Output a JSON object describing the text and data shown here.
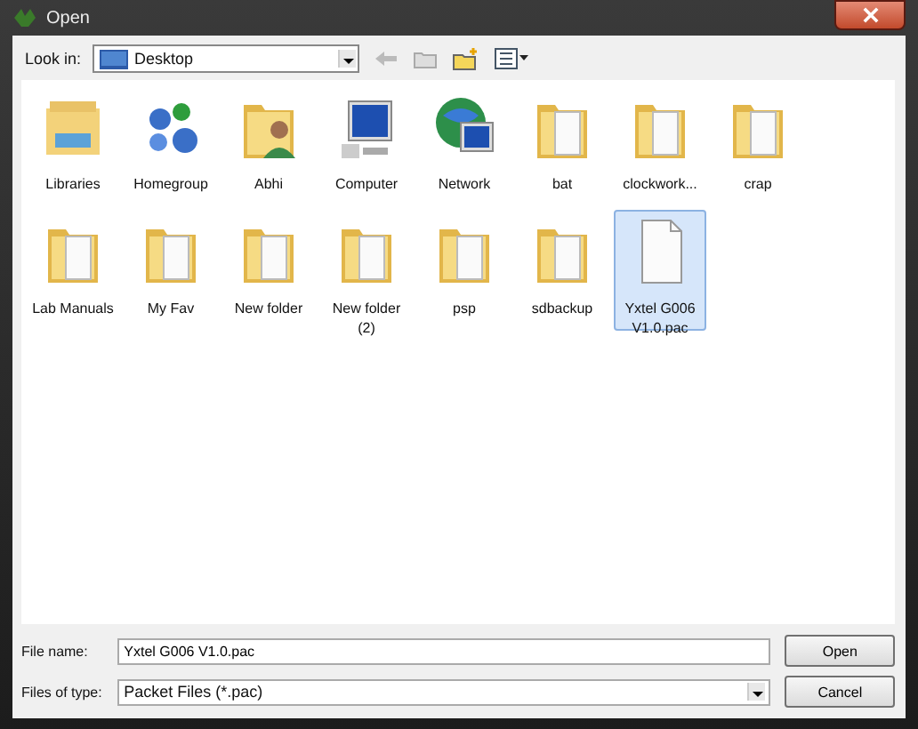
{
  "window": {
    "title": "Open"
  },
  "look_in": {
    "label": "Look in:",
    "value": "Desktop"
  },
  "items": [
    {
      "kind": "libraries",
      "label": "Libraries",
      "selected": false
    },
    {
      "kind": "homegroup",
      "label": "Homegroup",
      "selected": false
    },
    {
      "kind": "user",
      "label": "Abhi",
      "selected": false
    },
    {
      "kind": "computer",
      "label": "Computer",
      "selected": false
    },
    {
      "kind": "network",
      "label": "Network",
      "selected": false
    },
    {
      "kind": "folder",
      "label": "bat",
      "selected": false
    },
    {
      "kind": "folder",
      "label": "clockwork...",
      "selected": false
    },
    {
      "kind": "folder",
      "label": "crap",
      "selected": false
    },
    {
      "kind": "folder",
      "label": "Lab Manuals",
      "selected": false
    },
    {
      "kind": "folder",
      "label": "My Fav",
      "selected": false
    },
    {
      "kind": "folder",
      "label": "New folder",
      "selected": false
    },
    {
      "kind": "folder",
      "label": "New folder (2)",
      "selected": false
    },
    {
      "kind": "folder",
      "label": "psp",
      "selected": false
    },
    {
      "kind": "folder",
      "label": "sdbackup",
      "selected": false
    },
    {
      "kind": "file",
      "label": "Yxtel G006 V1.0.pac",
      "selected": true
    }
  ],
  "file_name": {
    "label": "File name:",
    "value": "Yxtel G006 V1.0.pac"
  },
  "file_type": {
    "label": "Files of type:",
    "value": "Packet Files (*.pac)"
  },
  "buttons": [
    "Open",
    "Cancel"
  ]
}
